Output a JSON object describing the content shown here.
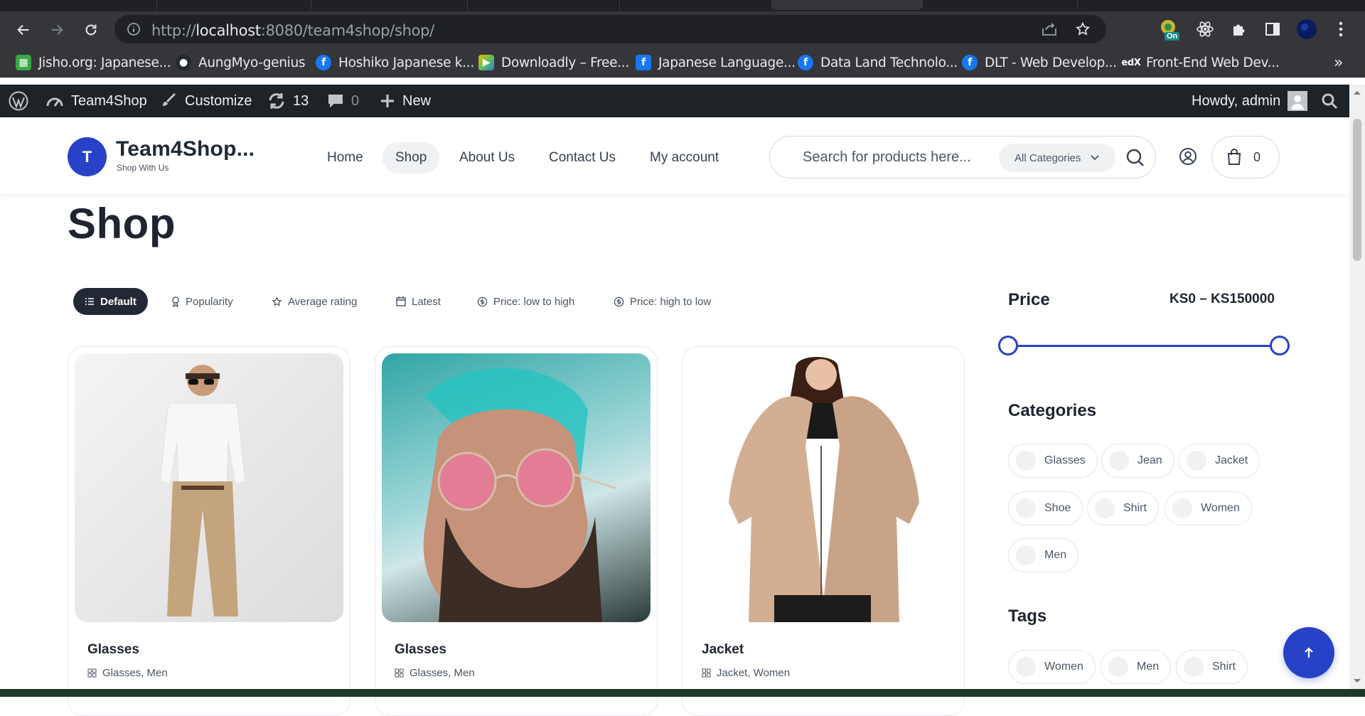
{
  "browser": {
    "url_scheme": "http://",
    "url_host": "localhost",
    "url_rest": ":8080/team4shop/shop/",
    "extension_badge": "On",
    "bookmarks": [
      {
        "label": "Jisho.org: Japanese...",
        "icon": "jisho-icon"
      },
      {
        "label": "AungMyo-genius",
        "icon": "github-icon"
      },
      {
        "label": "Hoshiko Japanese k...",
        "icon": "facebook-icon"
      },
      {
        "label": "Downloadly – Free...",
        "icon": "downloadly-icon"
      },
      {
        "label": "Japanese Language...",
        "icon": "facebook-icon"
      },
      {
        "label": "Data Land Technolo...",
        "icon": "facebook-icon"
      },
      {
        "label": "DLT - Web Develop...",
        "icon": "facebook-icon"
      },
      {
        "label": "Front-End Web Dev...",
        "icon": "edx-icon"
      }
    ],
    "more_bookmarks": "»"
  },
  "adminbar": {
    "site_name": "Team4Shop",
    "customize": "Customize",
    "updates_count": "13",
    "comments_count": "0",
    "new_label": "New",
    "howdy": "Howdy, admin"
  },
  "header": {
    "logo_letter": "T",
    "site_title": "Team4Shop...",
    "tagline": "Shop With Us",
    "nav": [
      "Home",
      "Shop",
      "About Us",
      "Contact Us",
      "My account"
    ],
    "search_placeholder": "Search for products here...",
    "category_select": "All Categories",
    "cart_count": "0"
  },
  "page": {
    "title": "Shop",
    "sort_options": [
      "Default",
      "Popularity",
      "Average rating",
      "Latest",
      "Price: low to high",
      "Price: high to low"
    ],
    "products": [
      {
        "title": "Glasses",
        "categories": "Glasses, Men"
      },
      {
        "title": "Glasses",
        "categories": "Glasses, Men"
      },
      {
        "title": "Jacket",
        "categories": "Jacket, Women"
      }
    ]
  },
  "sidebar": {
    "price_heading": "Price",
    "price_range": "KS0 – KS150000",
    "price_min_fraction": 0,
    "price_max_fraction": 1,
    "categories_heading": "Categories",
    "categories": [
      "Glasses",
      "Jean",
      "Jacket",
      "Shoe",
      "Shirt",
      "Women",
      "Men"
    ],
    "tags_heading": "Tags",
    "tags": [
      "Women",
      "Men",
      "Shirt"
    ]
  },
  "colors": {
    "accent": "#2742c6",
    "dark": "#222836",
    "admin_bar": "#1d2327",
    "chrome": "#35363a"
  }
}
